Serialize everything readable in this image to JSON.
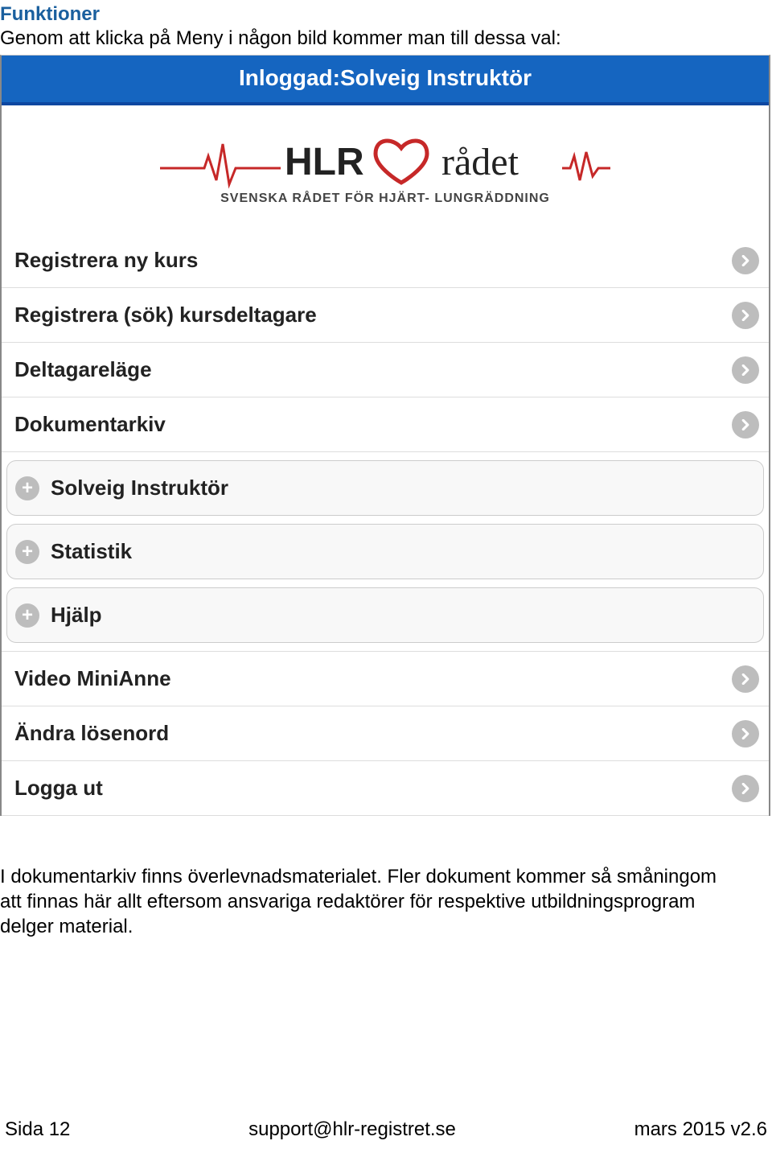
{
  "header": {
    "title": "Funktioner",
    "intro": "Genom att klicka på Meny i någon bild kommer man till dessa val:"
  },
  "login_bar": {
    "text": "Inloggad:Solveig Instruktör"
  },
  "logo": {
    "main_text_left": "HLR",
    "main_text_right": "rådet",
    "subtitle": "SVENSKA RÅDET FÖR HJÄRT- LUNGRÄDDNING"
  },
  "menu": {
    "items": [
      {
        "label": "Registrera ny kurs",
        "type": "chevron"
      },
      {
        "label": "Registrera (sök) kursdeltagare",
        "type": "chevron"
      },
      {
        "label": "Deltagareläge",
        "type": "chevron"
      },
      {
        "label": "Dokumentarkiv",
        "type": "chevron"
      },
      {
        "label": "Solveig Instruktör",
        "type": "plus"
      },
      {
        "label": "Statistik",
        "type": "plus"
      },
      {
        "label": "Hjälp",
        "type": "plus"
      },
      {
        "label": "Video MiniAnne",
        "type": "chevron"
      },
      {
        "label": "Ändra lösenord",
        "type": "chevron"
      },
      {
        "label": "Logga ut",
        "type": "chevron"
      }
    ]
  },
  "body_paragraph": "I dokumentarkiv finns överlevnadsmaterialet. Fler dokument kommer så småningom att finnas här allt eftersom ansvariga redaktörer för respektive utbildningsprogram delger material.",
  "footer": {
    "left": "Sida 12",
    "center": "support@hlr-registret.se",
    "right": "mars 2015 v2.6"
  }
}
